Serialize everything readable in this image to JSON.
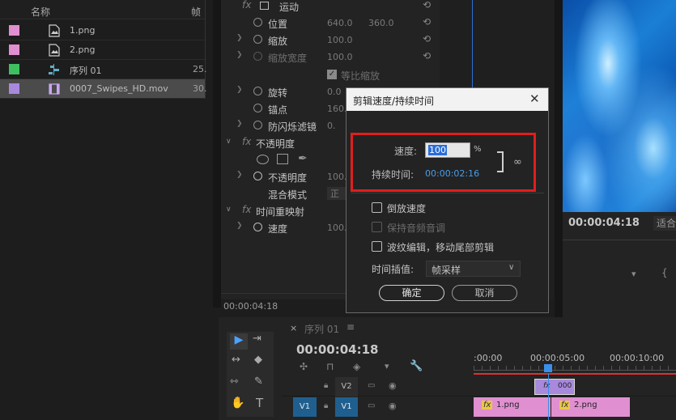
{
  "project": {
    "col_name": "名称",
    "col_rate": "帧",
    "items": [
      {
        "name": "1.png",
        "rate": "",
        "color": "#e08fd0"
      },
      {
        "name": "2.png",
        "rate": "",
        "color": "#e08fd0"
      },
      {
        "name": "序列 01",
        "rate": "25.",
        "color": "#3fbf5f"
      },
      {
        "name": "0007_Swipes_HD.mov",
        "rate": "30.",
        "color": "#a889dc"
      }
    ]
  },
  "effects": {
    "motion": "运动",
    "position": {
      "label": "位置",
      "x": "640.0",
      "y": "360.0"
    },
    "scale": {
      "label": "缩放",
      "value": "100.0"
    },
    "scale_width": {
      "label": "缩放宽度",
      "value": "100.0"
    },
    "uniform_scale": "等比缩放",
    "rotation": {
      "label": "旋转",
      "value": "0.0"
    },
    "anchor": {
      "label": "锚点",
      "value": "160."
    },
    "antiflicker": {
      "label": "防闪烁滤镜",
      "value": "0."
    },
    "opacity_group": "不透明度",
    "opacity": {
      "label": "不透明度",
      "value": "100."
    },
    "blend_mode": {
      "label": "混合模式",
      "value": "正"
    },
    "time_remap": "时间重映射",
    "speed": {
      "label": "速度",
      "value": "100."
    },
    "timecode": "00:00:04:18"
  },
  "program": {
    "timecode": "00:00:04:18",
    "fit": "适合"
  },
  "timeline": {
    "tab": "序列 01",
    "timecode": "00:00:04:18",
    "ruler": [
      ":00:00",
      "00:00:05:00",
      "00:00:10:00"
    ],
    "tracks": [
      {
        "target": "",
        "name": "V2"
      },
      {
        "target": "V1",
        "name": "V1"
      }
    ],
    "clip_v2": "000",
    "clip_a": "1.png",
    "clip_b": "2.png",
    "fx": "fx"
  },
  "dialog": {
    "title": "剪辑速度/持续时间",
    "speed_label": "速度:",
    "speed_value": "100",
    "speed_unit": "%",
    "duration_label": "持续时间:",
    "duration_value": "00:00:02:16",
    "reverse": "倒放速度",
    "maintain_audio": "保持音频音调",
    "ripple": "波纹编辑，移动尾部剪辑",
    "interp_label": "时间插值:",
    "interp_value": "帧采样",
    "ok": "确定",
    "cancel": "取消"
  }
}
